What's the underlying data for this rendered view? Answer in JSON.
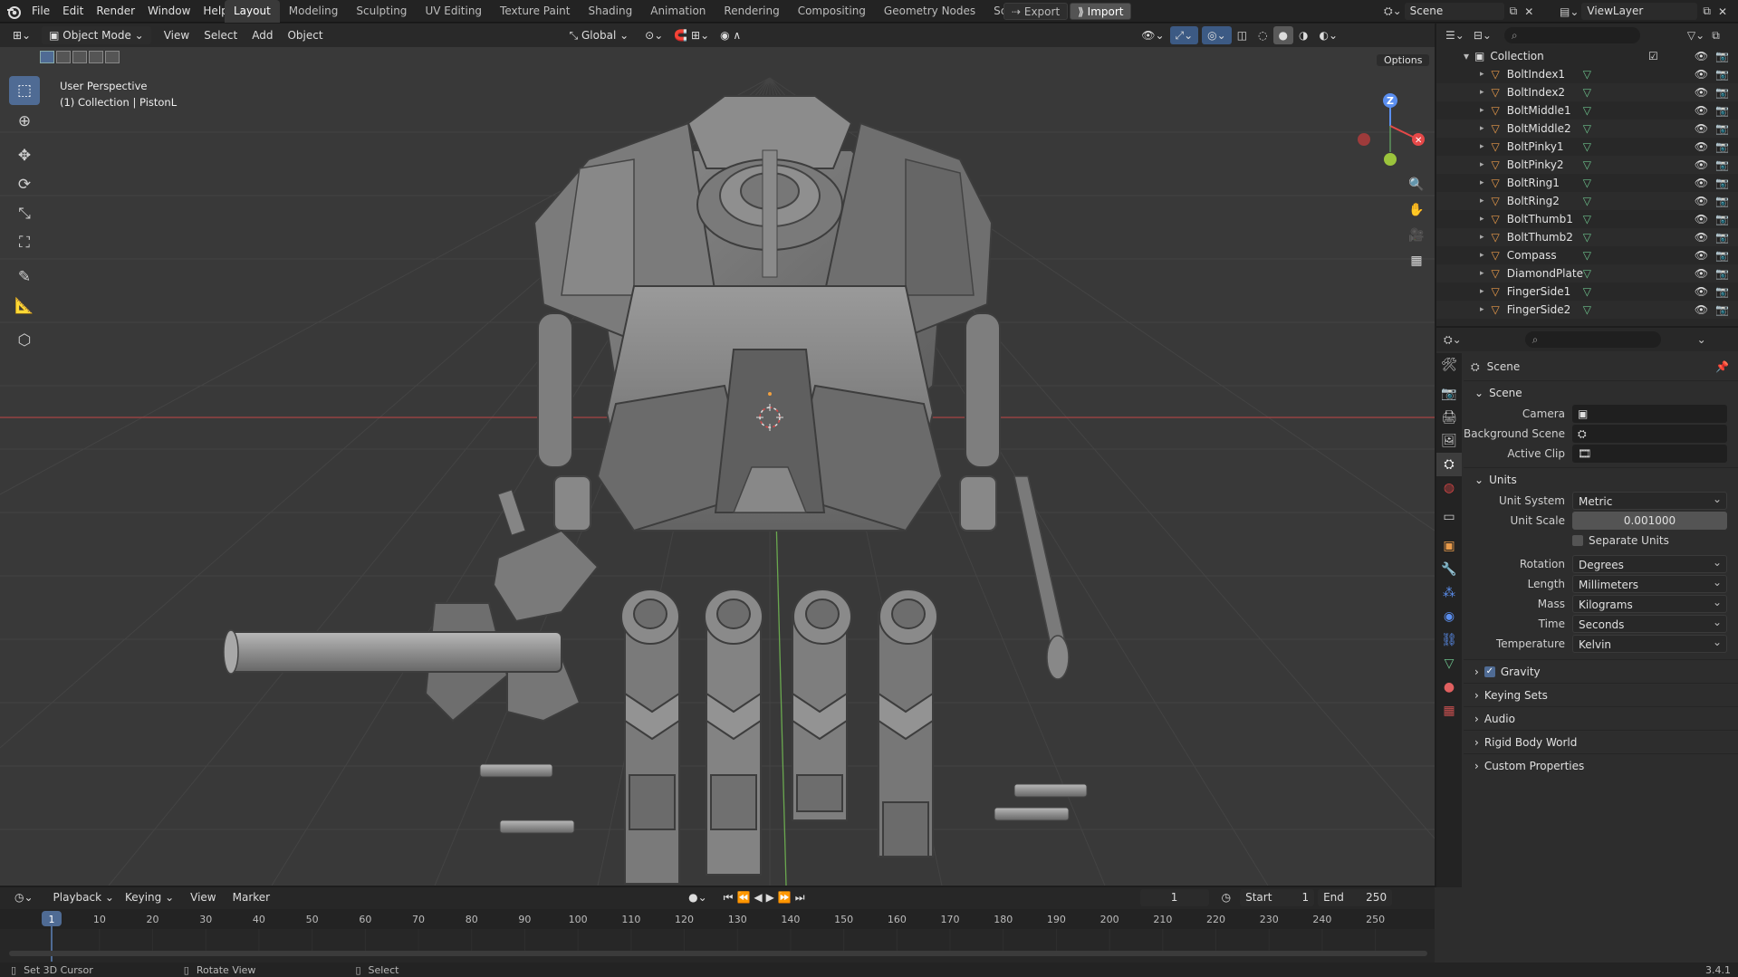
{
  "topbar": {
    "menus": [
      "File",
      "Edit",
      "Render",
      "Window",
      "Help"
    ],
    "workspaces": [
      "Layout",
      "Modeling",
      "Sculpting",
      "UV Editing",
      "Texture Paint",
      "Shading",
      "Animation",
      "Rendering",
      "Compositing",
      "Geometry Nodes",
      "Scripting"
    ],
    "active_workspace": "Layout",
    "export_label": "Export",
    "import_label": "Import",
    "scene_name": "Scene",
    "view_layer": "ViewLayer"
  },
  "viewport": {
    "mode": "Object Mode",
    "menus": [
      "View",
      "Select",
      "Add",
      "Object"
    ],
    "orientation": "Global",
    "options_label": "Options",
    "overlay_title": "User Perspective",
    "overlay_subtitle": "(1) Collection | PistonL",
    "gizmo_z": "Z"
  },
  "outliner": {
    "collection": "Collection",
    "items": [
      "BoltIndex1",
      "BoltIndex2",
      "BoltMiddle1",
      "BoltMiddle2",
      "BoltPinky1",
      "BoltPinky2",
      "BoltRing1",
      "BoltRing2",
      "BoltThumb1",
      "BoltThumb2",
      "Compass",
      "DiamondPlate",
      "FingerSide1",
      "FingerSide2"
    ]
  },
  "properties": {
    "header": "Scene",
    "scene_section": "Scene",
    "camera_label": "Camera",
    "bg_scene_label": "Background Scene",
    "active_clip_label": "Active Clip",
    "units_section": "Units",
    "unit_system_label": "Unit System",
    "unit_system": "Metric",
    "unit_scale_label": "Unit Scale",
    "unit_scale": "0.001000",
    "separate_units": "Separate Units",
    "rotation_label": "Rotation",
    "rotation": "Degrees",
    "length_label": "Length",
    "length": "Millimeters",
    "mass_label": "Mass",
    "mass": "Kilograms",
    "time_label": "Time",
    "time": "Seconds",
    "temperature_label": "Temperature",
    "temperature": "Kelvin",
    "gravity": "Gravity",
    "sections": [
      "Keying Sets",
      "Audio",
      "Rigid Body World",
      "Custom Properties"
    ]
  },
  "timeline": {
    "menus": [
      "Playback",
      "Keying",
      "View",
      "Marker"
    ],
    "current_frame": "1",
    "start_label": "Start",
    "start": "1",
    "end_label": "End",
    "end": "250",
    "ticks": [
      "10",
      "20",
      "30",
      "40",
      "50",
      "60",
      "70",
      "80",
      "90",
      "100",
      "110",
      "120",
      "130",
      "140",
      "150",
      "160",
      "170",
      "180",
      "190",
      "200",
      "210",
      "220",
      "230",
      "240",
      "250"
    ],
    "playhead": "1"
  },
  "statusbar": {
    "hint1": "Set 3D Cursor",
    "hint2": "Rotate View",
    "hint3": "Select",
    "version": "3.4.1"
  },
  "colors": {
    "accent": "#4f6b94",
    "orange": "#e89a4a",
    "mesh_green": "#6cc08b",
    "axis_red": "#b84444"
  }
}
